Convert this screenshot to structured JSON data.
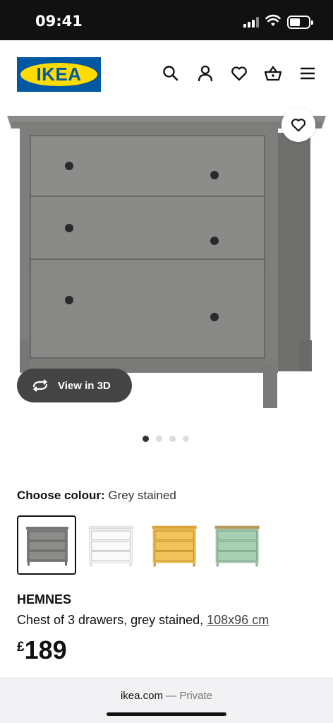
{
  "status_bar": {
    "time": "09:41"
  },
  "header": {
    "logo_text": "IKEA",
    "icons": [
      "search-icon",
      "account-icon",
      "heart-icon",
      "basket-icon",
      "menu-icon"
    ]
  },
  "product_image": {
    "view_3d_label": "View in 3D",
    "dots_total": 4,
    "dots_active": 1
  },
  "colour": {
    "label": "Choose colour:",
    "selected": "Grey stained",
    "swatches": [
      "grey stained",
      "white",
      "yellow",
      "green"
    ]
  },
  "product": {
    "name": "HEMNES",
    "description": "Chest of 3 drawers, grey stained, ",
    "dimensions": "108x96 cm",
    "currency": "£",
    "price": "189"
  },
  "browser": {
    "domain": "ikea.com",
    "separator": " — ",
    "mode": "Private"
  },
  "colors": {
    "ikea_blue": "#0058a3",
    "ikea_yellow": "#ffdb00"
  }
}
